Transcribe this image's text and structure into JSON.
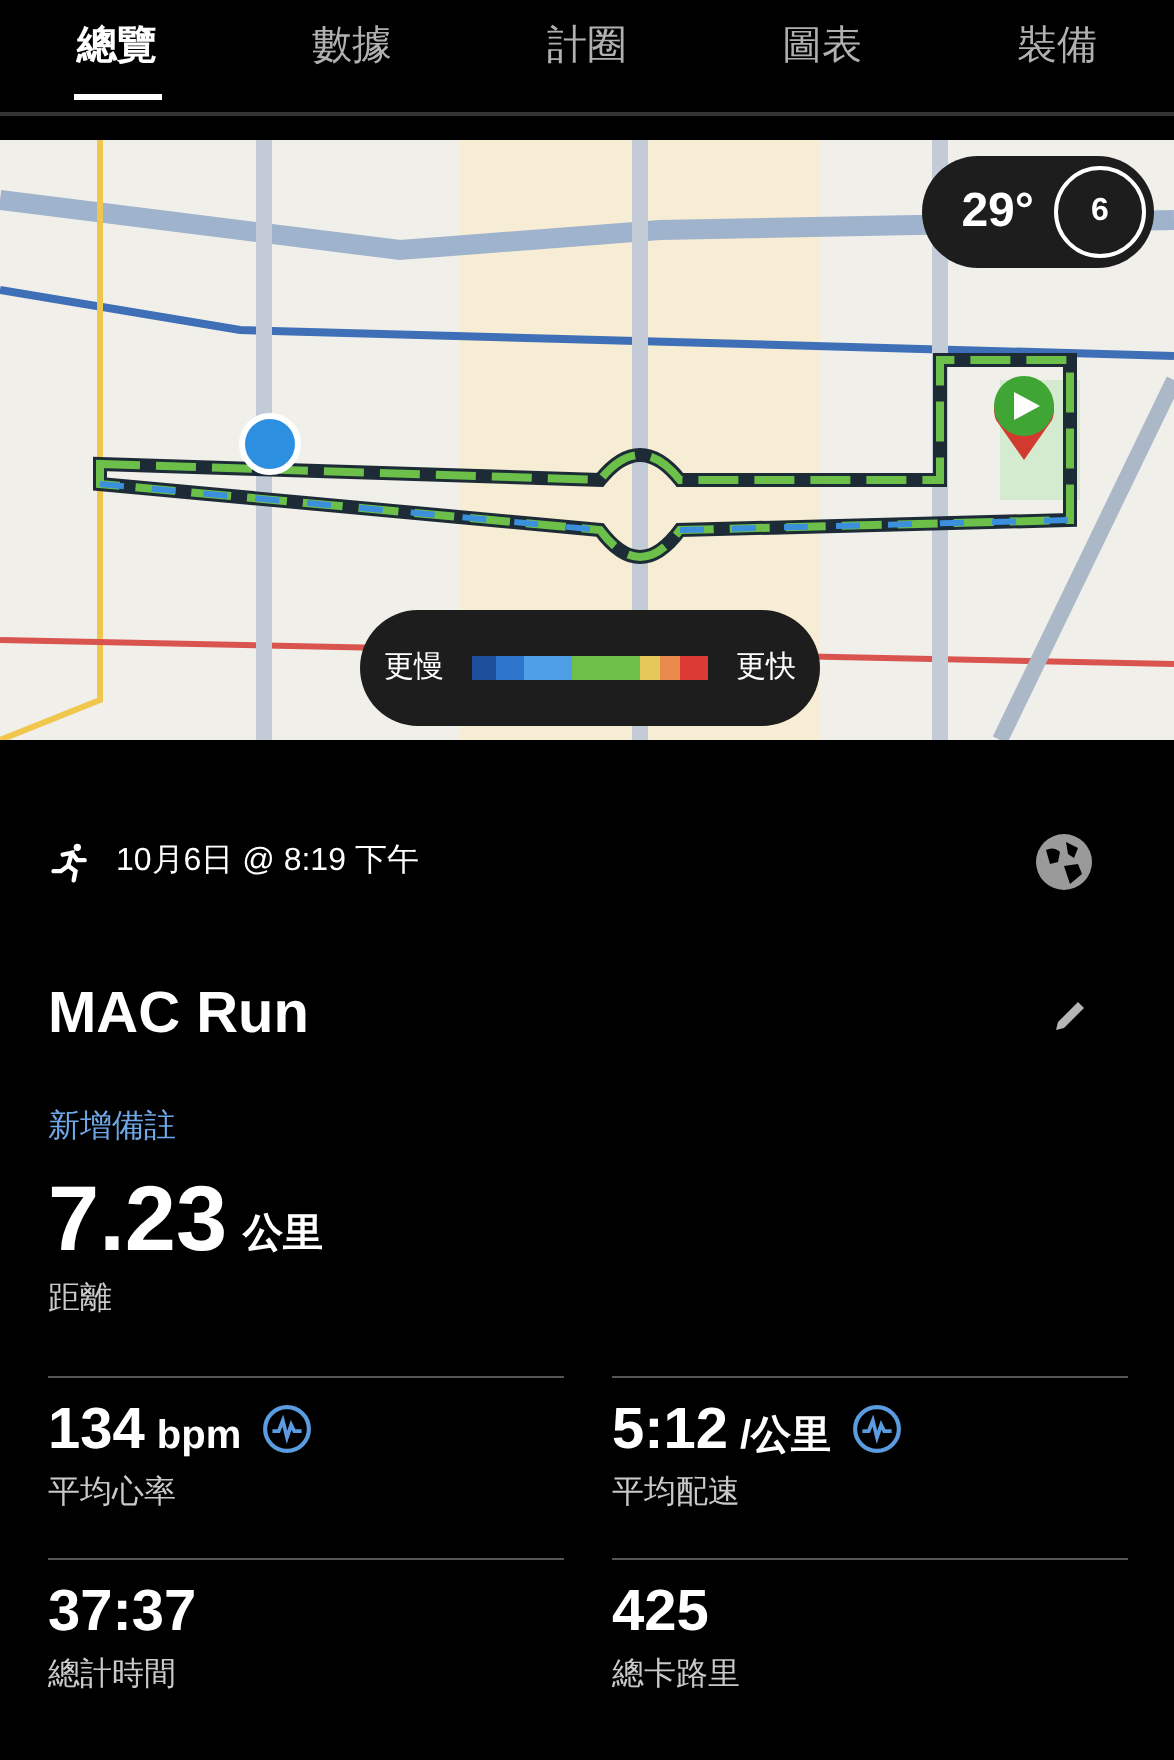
{
  "tabs": [
    {
      "label": "總覽",
      "selected": true
    },
    {
      "label": "數據",
      "selected": false
    },
    {
      "label": "計圈",
      "selected": false
    },
    {
      "label": "圖表",
      "selected": false
    },
    {
      "label": "裝備",
      "selected": false
    }
  ],
  "map": {
    "kind": "picture",
    "weather": {
      "temperature": "29°",
      "wind": "6"
    },
    "legend": {
      "slow": "更慢",
      "fast": "更快"
    }
  },
  "activity": {
    "datetime": "10月6日 @ 8:19 下午",
    "title": "MAC Run",
    "add_note": "新增備註",
    "distance": {
      "value": "7.23",
      "unit": "公里",
      "label": "距離"
    }
  },
  "metrics": [
    {
      "value": "134",
      "unit": "bpm",
      "label": "平均心率",
      "chart_link": true
    },
    {
      "value": "5:12",
      "unit": "/公里",
      "label": "平均配速",
      "chart_link": true
    },
    {
      "value": "37:37",
      "label": "總計時間",
      "chart_link": false
    },
    {
      "value": "425",
      "label": "總卡路里",
      "chart_link": false
    }
  ]
}
